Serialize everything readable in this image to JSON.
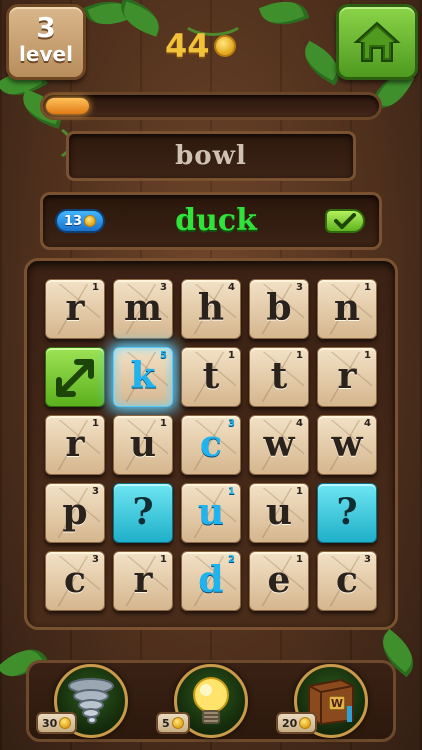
{
  "level": {
    "number": "3",
    "word": "level"
  },
  "coins": {
    "count": "44"
  },
  "progress": {
    "fraction": 0.13
  },
  "current_word": "bowl",
  "found": {
    "score": "13",
    "word": "duck"
  },
  "board": {
    "tiles": [
      {
        "letter": "r",
        "score": "1",
        "style": "wood"
      },
      {
        "letter": "m",
        "score": "3",
        "style": "wood"
      },
      {
        "letter": "h",
        "score": "4",
        "style": "wood"
      },
      {
        "letter": "b",
        "score": "3",
        "style": "wood"
      },
      {
        "letter": "n",
        "score": "1",
        "style": "wood"
      },
      {
        "letter": "",
        "score": "",
        "style": "green",
        "icon": "expand-arrows-icon"
      },
      {
        "letter": "k",
        "score": "5",
        "style": "selected-glow"
      },
      {
        "letter": "t",
        "score": "1",
        "style": "wood"
      },
      {
        "letter": "t",
        "score": "1",
        "style": "wood"
      },
      {
        "letter": "r",
        "score": "1",
        "style": "wood"
      },
      {
        "letter": "r",
        "score": "1",
        "style": "wood"
      },
      {
        "letter": "u",
        "score": "1",
        "style": "wood"
      },
      {
        "letter": "c",
        "score": "3",
        "style": "selected"
      },
      {
        "letter": "w",
        "score": "4",
        "style": "wood"
      },
      {
        "letter": "w",
        "score": "4",
        "style": "wood"
      },
      {
        "letter": "p",
        "score": "3",
        "style": "wood"
      },
      {
        "letter": "?",
        "score": "",
        "style": "blue"
      },
      {
        "letter": "u",
        "score": "1",
        "style": "selected"
      },
      {
        "letter": "u",
        "score": "1",
        "style": "wood"
      },
      {
        "letter": "?",
        "score": "",
        "style": "blue"
      },
      {
        "letter": "c",
        "score": "3",
        "style": "wood"
      },
      {
        "letter": "r",
        "score": "1",
        "style": "wood"
      },
      {
        "letter": "d",
        "score": "2",
        "style": "selected"
      },
      {
        "letter": "e",
        "score": "1",
        "style": "wood"
      },
      {
        "letter": "c",
        "score": "3",
        "style": "wood"
      }
    ]
  },
  "powerups": [
    {
      "name": "tornado-shuffle",
      "icon": "tornado-icon",
      "cost": "30"
    },
    {
      "name": "lightbulb-hint",
      "icon": "lightbulb-icon",
      "cost": "5"
    },
    {
      "name": "dictionary",
      "icon": "book-icon",
      "cost": "20"
    }
  ],
  "colors": {
    "found_word": "#31e23a",
    "selected_letter": "#1fb3f0",
    "coin_text": "#f2c33a"
  }
}
